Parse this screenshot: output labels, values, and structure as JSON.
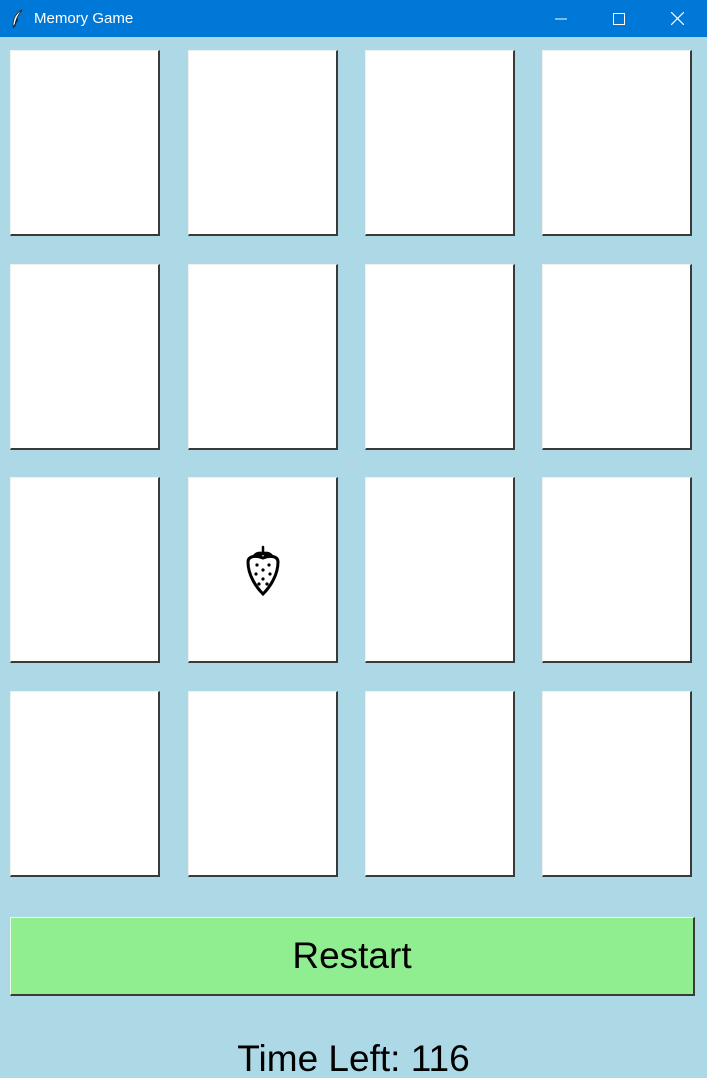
{
  "window": {
    "title": "Memory Game",
    "app_icon": "feather-icon",
    "controls": [
      "minimize-icon",
      "maximize-icon",
      "close-icon"
    ]
  },
  "board": {
    "rows": 4,
    "columns": 4,
    "cards": [
      {
        "revealed": false,
        "symbol": ""
      },
      {
        "revealed": false,
        "symbol": ""
      },
      {
        "revealed": false,
        "symbol": ""
      },
      {
        "revealed": false,
        "symbol": ""
      },
      {
        "revealed": false,
        "symbol": ""
      },
      {
        "revealed": false,
        "symbol": ""
      },
      {
        "revealed": false,
        "symbol": ""
      },
      {
        "revealed": false,
        "symbol": ""
      },
      {
        "revealed": false,
        "symbol": ""
      },
      {
        "revealed": true,
        "symbol": "strawberry-icon"
      },
      {
        "revealed": false,
        "symbol": ""
      },
      {
        "revealed": false,
        "symbol": ""
      },
      {
        "revealed": false,
        "symbol": ""
      },
      {
        "revealed": false,
        "symbol": ""
      },
      {
        "revealed": false,
        "symbol": ""
      },
      {
        "revealed": false,
        "symbol": ""
      }
    ]
  },
  "controls": {
    "restart_label": "Restart"
  },
  "status": {
    "timer_text": "Time Left: 116"
  },
  "colors": {
    "titlebar": "#0078d7",
    "background": "#add8e6",
    "card": "#ffffff",
    "restart_button": "#90ee90"
  }
}
